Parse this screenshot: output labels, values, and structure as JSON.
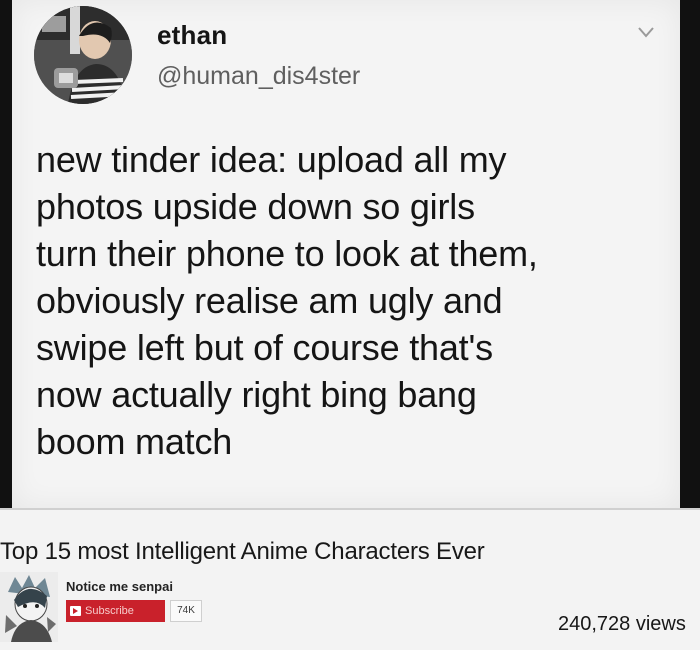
{
  "tweet": {
    "display_name": "ethan",
    "handle": "@human_dis4ster",
    "lines": [
      "new tinder idea: upload all my",
      "photos upside down so girls",
      "turn their phone to look at them,",
      "obviously realise am ugly and",
      "swipe left but of course that's",
      "now actually right bing bang",
      "boom match"
    ],
    "more_icon": "chevron-down-icon"
  },
  "video": {
    "title": "Top 15 most Intelligent Anime Characters Ever",
    "channel_name": "Notice me senpai",
    "subscribe_label": "Subscribe",
    "subscriber_count": "74K",
    "views": "240,728 views",
    "subscribe_icon": "play-icon"
  },
  "colors": {
    "subscribe_red": "#c9212b",
    "tweet_background": "#f4f4f4",
    "frame_black": "#111111"
  }
}
